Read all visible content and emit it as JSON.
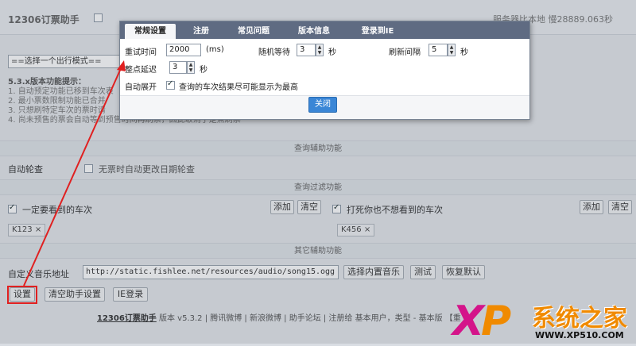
{
  "app": {
    "title": "12306订票助手",
    "status": "服务器比本地 慢28889.063秒"
  },
  "mode_select": {
    "value": "==选择一个出行模式=="
  },
  "tips": {
    "heading": "5.3.x版本功能提示：",
    "lines": [
      "1. 自动预定功能已移到车次表",
      "2. 最小票数限制功能已合并",
      "3. 只想刷特定车次的票时请",
      "4. 尚未预售的票会自动等到预售时间再刷票，因此取消了定点刷票"
    ]
  },
  "sections": {
    "query_assist": "查询辅助功能",
    "query_filter": "查询过滤功能",
    "other_assist": "其它辅助功能"
  },
  "query_assist": {
    "auto_rotate_label": "自动轮查",
    "auto_rotate_desc": "无票时自动更改日期轮查"
  },
  "filter": {
    "must_see_label": "一定要看到的车次",
    "must_see_add": "添加",
    "must_see_clear": "清空",
    "never_see_label": "打死你也不想看到的车次",
    "never_see_add": "添加",
    "never_see_clear": "清空",
    "must_see_tags": [
      "K123 ×"
    ],
    "never_see_tags": [
      "K456 ×"
    ]
  },
  "other": {
    "music_label": "自定义音乐地址",
    "music_url": "http://static.fishlee.net/resources/audio/song15.ogg",
    "choose_music": "选择内置音乐",
    "test": "测试",
    "restore": "恢复默认"
  },
  "bottom_buttons": {
    "settings": "设置",
    "clear_settings": "清空助手设置",
    "ie_login": "IE登录"
  },
  "footer": {
    "brand": "12306订票助手",
    "text": "版本 v5.3.2 | 腾讯微博 | 新浪微博 | 助手论坛 | 注册给 基本用户，类型 - 基本版 【重"
  },
  "dialog": {
    "tabs": [
      "常规设置",
      "注册",
      "常见问题",
      "版本信息",
      "登录到IE"
    ],
    "active_tab": 0,
    "retry_time_label": "重试时间",
    "retry_time_value": "2000",
    "retry_time_unit": "(ms)",
    "random_wait_label": "随机等待",
    "random_wait_value": "3",
    "random_wait_unit": "秒",
    "refresh_interval_label": "刷新间隔",
    "refresh_interval_value": "5",
    "refresh_interval_unit": "秒",
    "whole_delay_label": "整点延迟",
    "whole_delay_value": "3",
    "whole_delay_unit": "秒",
    "auto_expand_label": "自动展开",
    "auto_expand_desc": "查询的车次结果尽可能显示为最高",
    "close": "关闭"
  },
  "watermark": {
    "logo": "XP",
    "site_name": "系统之家",
    "url": "WWW.XP510.COM"
  },
  "colors": {
    "tab_bar": "#5f6b82",
    "close_button": "#3a86d6",
    "annotation": "#e02020",
    "watermark_magenta": "#d4148a",
    "watermark_orange": "#f08a00"
  }
}
